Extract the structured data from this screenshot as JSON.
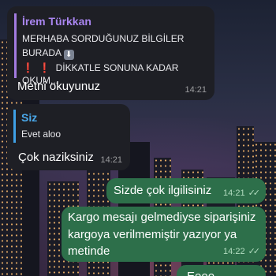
{
  "messages": [
    {
      "reply_name": "İrem Türkkan",
      "reply_line1": "MERHABA SORDUĞUNUZ BİLGİLER",
      "reply_line2": "BURADA",
      "reply_line3": "DİKKATLE SONUNA KADAR OKUM...",
      "text": "Metni okuyunuz",
      "time": "14:21"
    },
    {
      "reply_name": "Siz",
      "reply_line1": "Evet aloo",
      "text": "Çok naziksiniz",
      "time": "14:21"
    },
    {
      "text": "Sizde çok ilgilisiniz",
      "time": "14:21"
    },
    {
      "text_line1": "Kargo mesajı gelmediyse siparişiniz",
      "text_line2": "kargoya verilmemiştir yazıyor ya",
      "text_line3": "metinde",
      "time": "14:22"
    },
    {
      "text": "Eeee"
    }
  ],
  "icons": {
    "down_arrow": "⬇",
    "exclaim": "❗",
    "read_ticks": "✓✓"
  },
  "colors": {
    "incoming_bubble": "#1e1f25",
    "outgoing_bubble": "#2d6f4a",
    "reply_accent_purple": "#a37be0",
    "reply_accent_blue": "#3fa0e6"
  }
}
